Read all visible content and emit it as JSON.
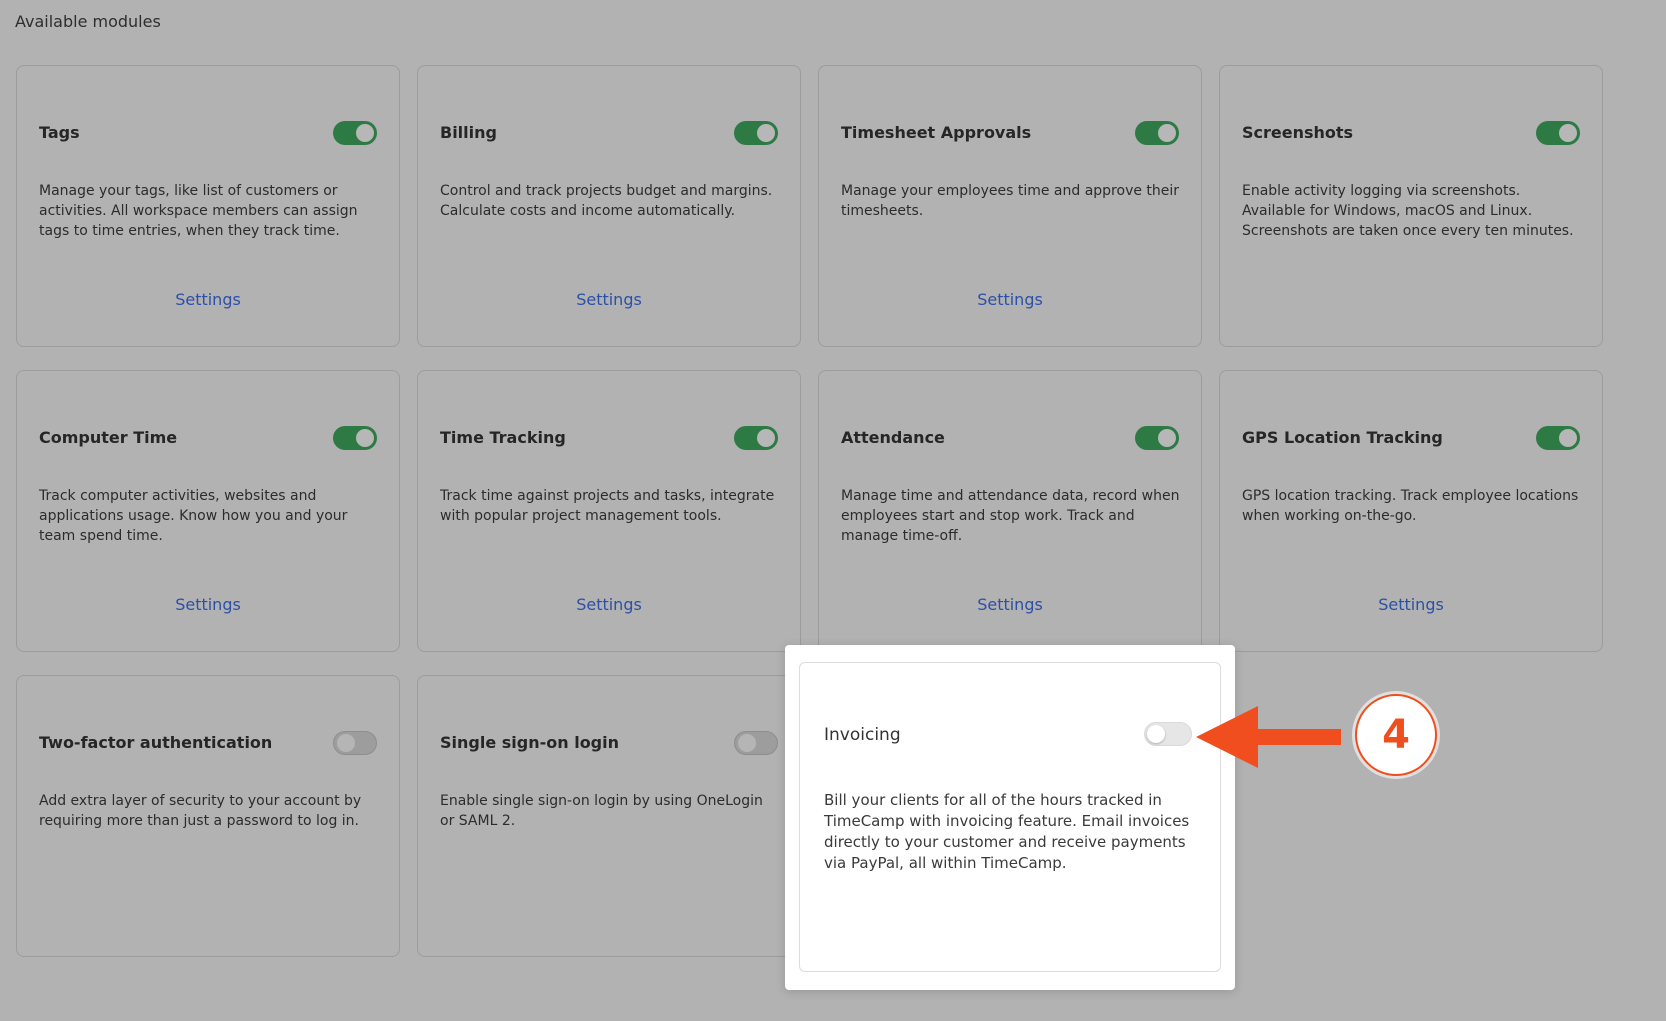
{
  "page": {
    "section_title": "Available modules"
  },
  "modules": [
    {
      "title": "Tags",
      "enabled": true,
      "description": "Manage your tags, like list of customers or activities. All workspace members can assign tags to time entries, when they track time.",
      "settings_label": "Settings"
    },
    {
      "title": "Billing",
      "enabled": true,
      "description": "Control and track projects budget and margins. Calculate costs and income automatically.",
      "settings_label": "Settings"
    },
    {
      "title": "Timesheet Approvals",
      "enabled": true,
      "description": "Manage your employees time and approve their timesheets.",
      "settings_label": "Settings"
    },
    {
      "title": "Screenshots",
      "enabled": true,
      "description": "Enable activity logging via screenshots. Available for Windows, macOS and Linux. Screenshots are taken once every ten minutes.",
      "settings_label": ""
    },
    {
      "title": "Computer Time",
      "enabled": true,
      "description": "Track computer activities, websites and applications usage. Know how you and your team spend time.",
      "settings_label": "Settings"
    },
    {
      "title": "Time Tracking",
      "enabled": true,
      "description": "Track time against projects and tasks, integrate with popular project management tools.",
      "settings_label": "Settings"
    },
    {
      "title": "Attendance",
      "enabled": true,
      "description": "Manage time and attendance data, record when employees start and stop work. Track and manage time-off.",
      "settings_label": "Settings"
    },
    {
      "title": "GPS Location Tracking",
      "enabled": true,
      "description": "GPS location tracking. Track employee locations when working on-the-go.",
      "settings_label": "Settings"
    },
    {
      "title": "Two-factor authentication",
      "enabled": false,
      "description": "Add extra layer of security to your account by requiring more than just a password to log in.",
      "settings_label": ""
    },
    {
      "title": "Single sign-on login",
      "enabled": false,
      "description": "Enable single sign-on login by using OneLogin or SAML 2.",
      "settings_label": ""
    }
  ],
  "highlight": {
    "title": "Invoicing",
    "enabled": false,
    "description": "Bill your clients for all of the hours tracked in TimeCamp with invoicing feature. Email invoices directly to your customer and receive payments via PayPal, all within TimeCamp.",
    "step_number": "4",
    "arrow_icon": "arrow-left-icon"
  },
  "colors": {
    "toggle_on": "#2d7a45",
    "link": "#2c4fa7",
    "annotation": "#f04e1e",
    "overlay_background": "#b2b2b2"
  }
}
